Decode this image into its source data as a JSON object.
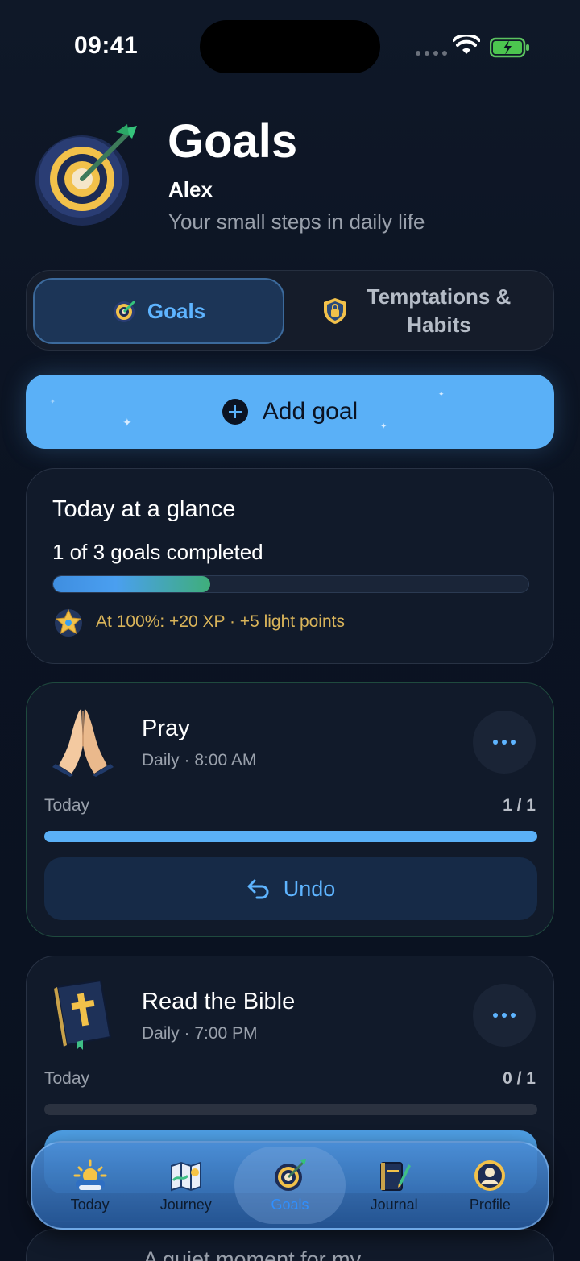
{
  "status_bar": {
    "time": "09:41"
  },
  "header": {
    "title": "Goals",
    "user_name": "Alex",
    "subtitle": "Your small steps in daily life"
  },
  "segments": {
    "goals_label": "Goals",
    "habits_label": "Temptations & Habits"
  },
  "add_goal": {
    "label": "Add goal"
  },
  "glance": {
    "title": "Today at a glance",
    "summary": "1 of 3 goals completed",
    "progress": 0.33,
    "reward_text": "At 100%: +20 XP · +5 light points"
  },
  "goals": [
    {
      "name": "Pray",
      "meta": "Daily · 8:00 AM",
      "today_label": "Today",
      "count": "1 / 1",
      "action_label": "Undo"
    },
    {
      "name": "Read the Bible",
      "meta": "Daily · 7:00 PM",
      "today_label": "Today",
      "count": "0 / 1"
    }
  ],
  "peek_card": {
    "name": "A quiet moment for my"
  },
  "tabbar": {
    "items": [
      {
        "label": "Today",
        "icon": "sunrise-icon"
      },
      {
        "label": "Journey",
        "icon": "map-icon"
      },
      {
        "label": "Goals",
        "icon": "target-icon",
        "active": true
      },
      {
        "label": "Journal",
        "icon": "journal-icon"
      },
      {
        "label": "Profile",
        "icon": "profile-icon"
      }
    ]
  },
  "colors": {
    "accent": "#5AB0F7",
    "background": "#0B1322",
    "reward": "#D9B45A",
    "card": "#111A2A"
  }
}
